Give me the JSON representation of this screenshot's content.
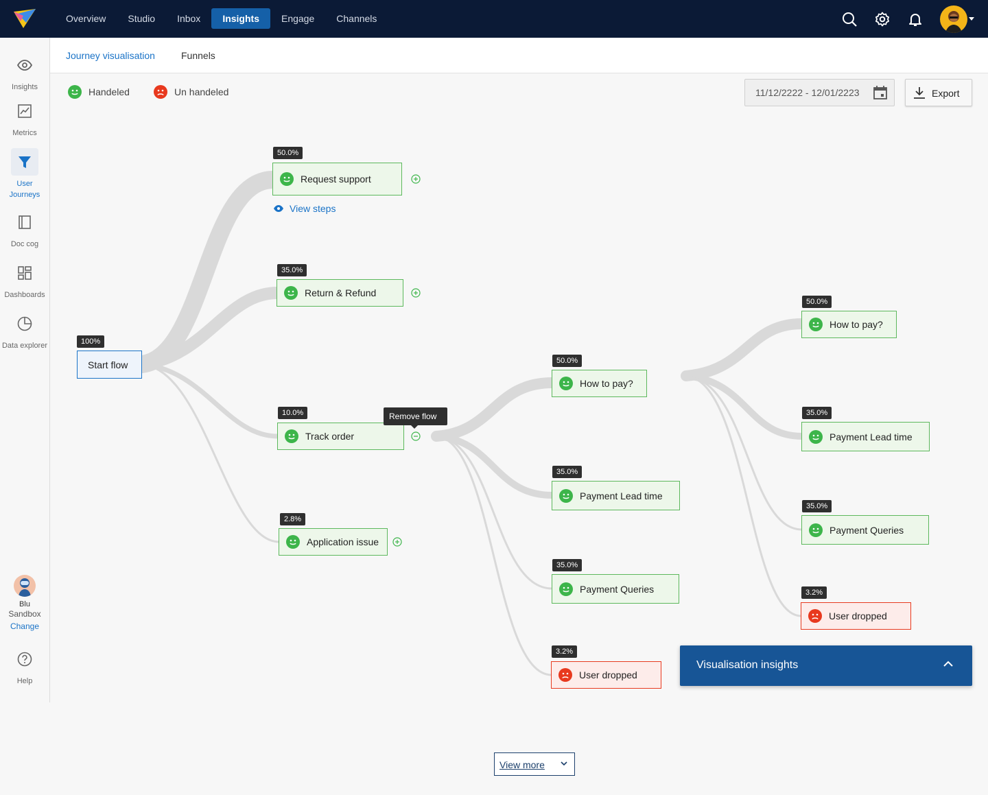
{
  "topnav": {
    "items": [
      {
        "label": "Overview",
        "active": false
      },
      {
        "label": "Studio",
        "active": false
      },
      {
        "label": "Inbox",
        "active": false
      },
      {
        "label": "Insights",
        "active": true
      },
      {
        "label": "Engage",
        "active": false
      },
      {
        "label": "Channels",
        "active": false
      }
    ],
    "icons": [
      "search-icon",
      "gear-icon",
      "bell-icon",
      "user-avatar"
    ]
  },
  "sidebar": {
    "items": [
      {
        "label": "Insights",
        "icon": "eye-icon"
      },
      {
        "label": "Metrics",
        "icon": "chart-icon"
      },
      {
        "label": "User Journeys",
        "icon": "funnel-icon",
        "active": true
      },
      {
        "label": "Doc cog",
        "icon": "notebook-icon"
      },
      {
        "label": "Dashboards",
        "icon": "dashboard-icon"
      },
      {
        "label": "Data explorer",
        "icon": "pie-icon"
      }
    ],
    "bot": {
      "name": "Blu",
      "workspace": "Sandbox",
      "change_label": "Change"
    },
    "help_label": "Help"
  },
  "subtabs": [
    {
      "label": "Journey visualisation",
      "active": true
    },
    {
      "label": "Funnels",
      "active": false
    }
  ],
  "legend": {
    "handled": "Handeled",
    "unhandled": "Un handeled"
  },
  "date_range": "11/12/2222 - 12/01/2223",
  "export_label": "Export",
  "colors": {
    "handled": "#3db54a",
    "unhandled": "#e8391e",
    "accent": "#1a73c7",
    "topbar": "#0b1a36"
  },
  "nodes": {
    "start": {
      "label": "Start flow",
      "pct": "100%"
    },
    "request_support": {
      "label": "Request support",
      "pct": "50.0%"
    },
    "return_refund": {
      "label": "Return & Refund",
      "pct": "35.0%"
    },
    "track_order": {
      "label": "Track order",
      "pct": "10.0%"
    },
    "application_issue": {
      "label": "Application issue",
      "pct": "2.8%"
    },
    "l2_how_to_pay": {
      "label": "How to pay?",
      "pct": "50.0%"
    },
    "l2_payment_lead_time": {
      "label": "Payment Lead time",
      "pct": "35.0%"
    },
    "l2_payment_queries": {
      "label": "Payment Queries",
      "pct": "35.0%"
    },
    "l2_user_dropped": {
      "label": "User dropped",
      "pct": "3.2%"
    },
    "l3_how_to_pay": {
      "label": "How to pay?",
      "pct": "50.0%"
    },
    "l3_payment_lead_time": {
      "label": "Payment Lead time",
      "pct": "35.0%"
    },
    "l3_payment_queries": {
      "label": "Payment Queries",
      "pct": "35.0%"
    },
    "l3_user_dropped": {
      "label": "User dropped",
      "pct": "3.2%"
    }
  },
  "view_steps_label": "View steps",
  "tooltip_label": "Remove flow",
  "insights_panel_title": "Visualisation insights",
  "view_more_label": "View more"
}
